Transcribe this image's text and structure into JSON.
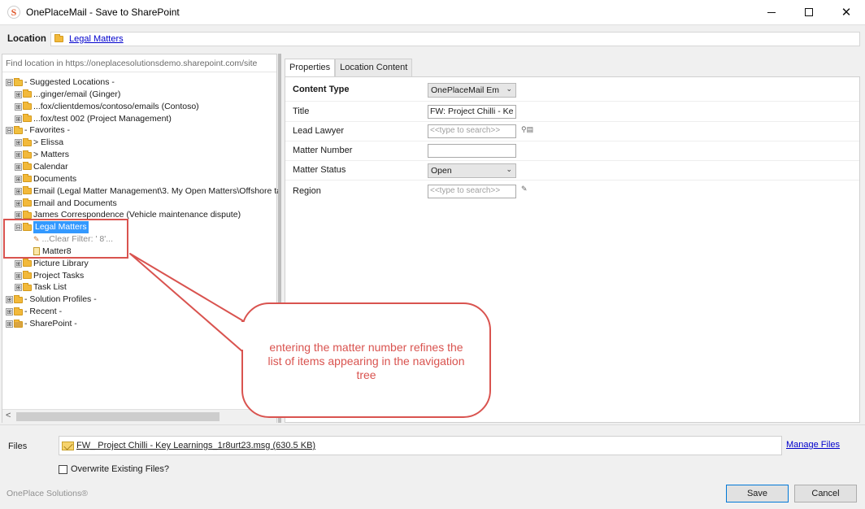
{
  "window": {
    "app_icon_letter": "S",
    "title": "OnePlaceMail - Save to SharePoint"
  },
  "location": {
    "label": "Location",
    "value": "Legal Matters"
  },
  "left_panel": {
    "find_placeholder": "Find location in https://oneplacesolutionsdemo.sharepoint.com/site",
    "tree": [
      {
        "label": "- Suggested Locations -",
        "expander": "⊟",
        "icon": "star-folder-icon"
      },
      {
        "label": "...ginger/email (Ginger)",
        "expander": "⊞",
        "icon": "folder-icon"
      },
      {
        "label": "...fox/clientdemos/contoso/emails (Contoso)",
        "expander": "⊞",
        "icon": "folder-icon"
      },
      {
        "label": "...fox/test 002 (Project Management)",
        "expander": "⊞",
        "icon": "folder-icon"
      },
      {
        "label": "- Favorites -",
        "expander": "⊟",
        "icon": "star-folder-icon"
      },
      {
        "label": "> Elissa",
        "expander": "⊞",
        "icon": "folder-icon"
      },
      {
        "label": "> Matters",
        "expander": "⊞",
        "icon": "folder-icon"
      },
      {
        "label": "Calendar",
        "expander": "⊞",
        "icon": "folder-icon"
      },
      {
        "label": "Documents",
        "expander": "⊞",
        "icon": "folder-icon"
      },
      {
        "label": "Email (Legal Matter Management\\3. My Open Matters\\Offshore ta",
        "expander": "⊞",
        "icon": "folder-icon"
      },
      {
        "label": "Email and Documents",
        "expander": "⊞",
        "icon": "folder-icon"
      },
      {
        "label": "James Correspondence (Vehicle maintenance dispute)",
        "expander": "⊞",
        "icon": "folder-icon"
      },
      {
        "label": "Legal Matters",
        "expander": "⊟",
        "icon": "folder-icon"
      },
      {
        "label": "...Clear Filter: ' 8'...",
        "expander": "",
        "icon": "filter-icon"
      },
      {
        "label": "Matter8",
        "expander": "",
        "icon": "document-icon"
      },
      {
        "label": "Picture Library",
        "expander": "⊞",
        "icon": "folder-icon"
      },
      {
        "label": "Project Tasks",
        "expander": "⊞",
        "icon": "folder-icon"
      },
      {
        "label": "Task List",
        "expander": "⊞",
        "icon": "folder-icon"
      },
      {
        "label": "- Solution Profiles -",
        "expander": "⊞",
        "icon": "folder-icon"
      },
      {
        "label": "- Recent -",
        "expander": "⊞",
        "icon": "folder-icon"
      },
      {
        "label": "- SharePoint -",
        "expander": "⊞",
        "icon": "sharepoint-folder-icon"
      }
    ],
    "scroll_left_arrow": "<"
  },
  "tabs": [
    {
      "label": "Properties",
      "active": true
    },
    {
      "label": "Location Content",
      "active": false
    }
  ],
  "properties": {
    "content_type": {
      "label": "Content Type",
      "value": "OnePlaceMail Em"
    },
    "title": {
      "label": "Title",
      "value": "FW: Project Chilli - Ke"
    },
    "lead_lawyer": {
      "label": "Lead Lawyer",
      "placeholder": "<<type to search>>"
    },
    "matter_number": {
      "label": "Matter Number",
      "value": ""
    },
    "matter_status": {
      "label": "Matter Status",
      "value": "Open"
    },
    "region": {
      "label": "Region",
      "placeholder": "<<type to search>>"
    }
  },
  "callout": {
    "text": "entering the matter number refines the list of items appearing in the navigation tree",
    "color": "#d9534f"
  },
  "files": {
    "label": "Files",
    "file_name": "FW_ Project Chilli - Key Learnings_1r8urt23.msg (630.5 KB)",
    "manage_link": "Manage Files",
    "overwrite_label": "Overwrite Existing Files?",
    "overwrite_checked": false
  },
  "footer": {
    "brand": "OnePlace Solutions®",
    "save_label": "Save",
    "cancel_label": "Cancel"
  },
  "colors": {
    "accent": "#0078d7",
    "selection": "#3399ff",
    "link": "#0000cc"
  }
}
